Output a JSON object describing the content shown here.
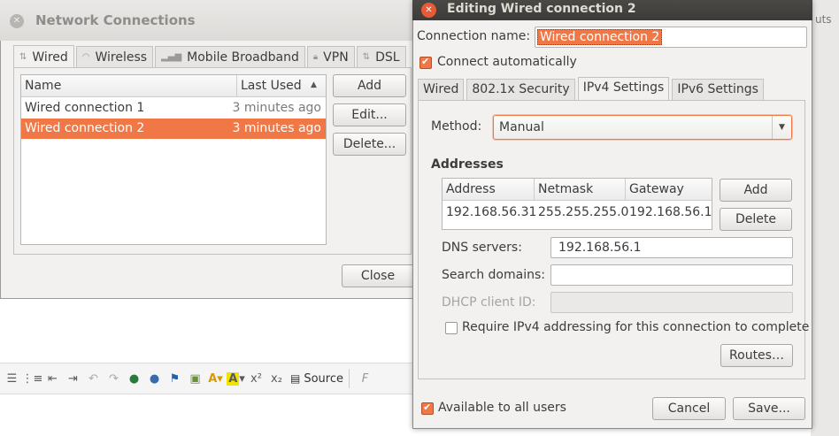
{
  "network_connections": {
    "title": "Network Connections",
    "tabs": [
      {
        "label": "Wired",
        "icon": "wired-icon"
      },
      {
        "label": "Wireless",
        "icon": "wireless-icon"
      },
      {
        "label": "Mobile Broadband",
        "icon": "signal-icon"
      },
      {
        "label": "VPN",
        "icon": "lock-icon"
      },
      {
        "label": "DSL",
        "icon": "dsl-icon"
      }
    ],
    "columns": {
      "name": "Name",
      "last_used": "Last Used"
    },
    "rows": [
      {
        "name": "Wired connection 1",
        "last_used": "3 minutes ago"
      },
      {
        "name": "Wired connection 2",
        "last_used": "3 minutes ago"
      }
    ],
    "buttons": {
      "add": "Add",
      "edit": "Edit...",
      "delete": "Delete...",
      "close": "Close"
    }
  },
  "editor": {
    "title": "Editing Wired connection 2",
    "connection_name_label": "Connection name:",
    "connection_name_value": "Wired connection 2",
    "connect_automatically": "Connect automatically",
    "tabs": [
      "Wired",
      "802.1x Security",
      "IPv4 Settings",
      "IPv6 Settings"
    ],
    "method_label": "Method:",
    "method_value": "Manual",
    "addresses_heading": "Addresses",
    "address_columns": [
      "Address",
      "Netmask",
      "Gateway"
    ],
    "address_row": {
      "address": "192.168.56.31",
      "netmask": "255.255.255.0",
      "gateway": "192.168.56.1"
    },
    "add_button": "Add",
    "delete_button": "Delete",
    "dns_label": "DNS servers:",
    "dns_value": "192.168.56.1",
    "search_domains_label": "Search domains:",
    "search_domains_value": "",
    "dhcp_client_id_label": "DHCP client ID:",
    "require_ipv4": "Require IPv4 addressing for this connection to complete",
    "routes_button": "Routes…",
    "available_to_all": "Available to all users",
    "cancel_button": "Cancel",
    "save_button": "Save..."
  },
  "background": {
    "source_label": "Source",
    "right_edge_text": "uts"
  },
  "colors": {
    "accent": "#f07746",
    "titlebar": "#3c3b37",
    "window_bg": "#f2f1f0"
  }
}
